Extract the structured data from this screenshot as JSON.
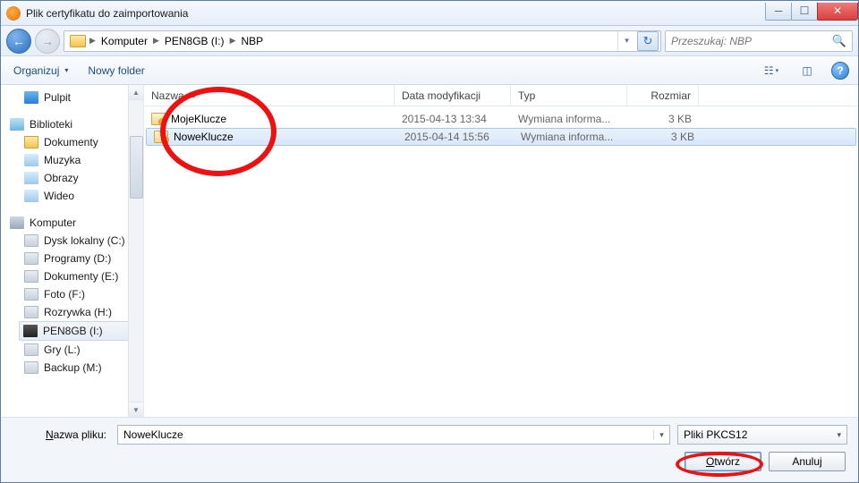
{
  "window": {
    "title": "Plik certyfikatu do zaimportowania"
  },
  "breadcrumb": {
    "root": "Komputer",
    "parts": [
      "PEN8GB (I:)",
      "NBP"
    ]
  },
  "search": {
    "placeholder": "Przeszukaj: NBP"
  },
  "toolbar": {
    "organize": "Organizuj",
    "new_folder": "Nowy folder"
  },
  "tree": {
    "desktop": "Pulpit",
    "libraries": "Biblioteki",
    "documents": "Dokumenty",
    "music": "Muzyka",
    "pictures": "Obrazy",
    "videos": "Wideo",
    "computer": "Komputer",
    "drives": [
      "Dysk lokalny (C:)",
      "Programy (D:)",
      "Dokumenty (E:)",
      "Foto (F:)",
      "Rozrywka (H:)",
      "PEN8GB (I:)",
      "Gry (L:)",
      "Backup (M:)"
    ]
  },
  "columns": {
    "name": "Nazwa",
    "date": "Data modyfikacji",
    "type": "Typ",
    "size": "Rozmiar"
  },
  "files": [
    {
      "name": "MojeKlucze",
      "date": "2015-04-13 13:34",
      "type": "Wymiana informa...",
      "size": "3 KB"
    },
    {
      "name": "NoweKlucze",
      "date": "2015-04-14 15:56",
      "type": "Wymiana informa...",
      "size": "3 KB"
    }
  ],
  "footer": {
    "filename_label_pre": "N",
    "filename_label_post": "azwa pliku:",
    "filename_value": "NoweKlucze",
    "filetype": "Pliki PKCS12",
    "open_pre": "O",
    "open_post": "twórz",
    "cancel": "Anuluj"
  }
}
